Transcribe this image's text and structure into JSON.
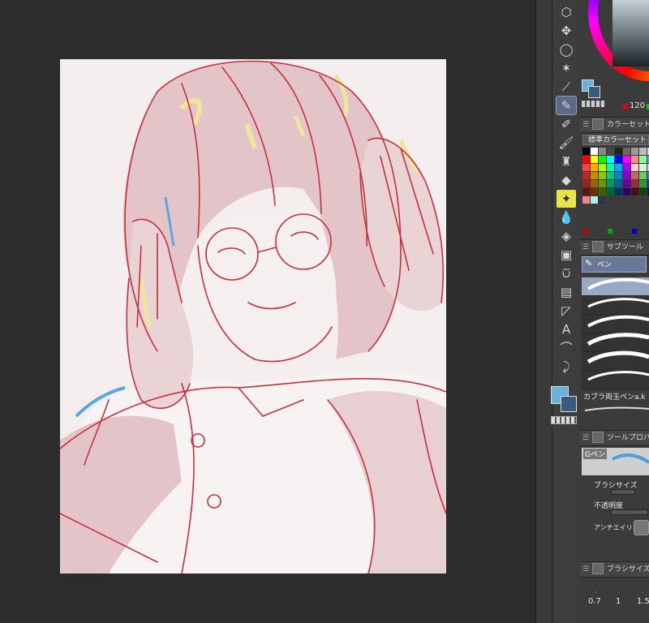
{
  "toolbar": {
    "tools": [
      {
        "name": "object-select-icon",
        "glyph": "⬡"
      },
      {
        "name": "move-icon",
        "glyph": "✥"
      },
      {
        "name": "lasso-icon",
        "glyph": "◯"
      },
      {
        "name": "magic-wand-icon",
        "glyph": "✶"
      },
      {
        "name": "eyedropper-icon",
        "glyph": "⟋"
      },
      {
        "name": "pen-tool-icon",
        "glyph": "✎",
        "active": true
      },
      {
        "name": "pencil-tool-icon",
        "glyph": "✐"
      },
      {
        "name": "brush-tool-icon",
        "glyph": "🖌"
      },
      {
        "name": "airbrush-tool-icon",
        "glyph": "♜"
      },
      {
        "name": "eraser-tool-icon",
        "glyph": "◆"
      },
      {
        "name": "decoration-tool-icon",
        "glyph": "✦",
        "highlight": true
      },
      {
        "name": "blend-tool-icon",
        "glyph": "💧"
      },
      {
        "name": "fill-tool-icon",
        "glyph": "◈"
      },
      {
        "name": "gradient-tool-icon",
        "glyph": "▣"
      },
      {
        "name": "figure-tool-icon",
        "glyph": "⩂"
      },
      {
        "name": "frame-tool-icon",
        "glyph": "▤"
      },
      {
        "name": "ruler-tool-icon",
        "glyph": "◸"
      },
      {
        "name": "text-tool-icon",
        "glyph": "A"
      },
      {
        "name": "balloon-tool-icon",
        "glyph": "⌒"
      },
      {
        "name": "correct-line-tool-icon",
        "glyph": "⤸"
      }
    ],
    "main_color": "#6ab0dc",
    "sub_color": "#3a5c7a"
  },
  "color_wheel": {
    "red_value": "120"
  },
  "color_set": {
    "panel_title": "カラーセット",
    "set_name": "標準カラーセット"
  },
  "sub_tool": {
    "panel_title": "サブツール",
    "group_name": "ペン",
    "brush_label": "カブラ両玉ペンa.k"
  },
  "tool_property": {
    "panel_title": "ツールプロパティ",
    "tool_name": "Gペン",
    "brush_size_label": "ブラシサイズ",
    "opacity_label": "不透明度",
    "antialias_label": "アンチエイリアス"
  },
  "brush_size": {
    "panel_title": "ブラシサイズ",
    "sizes": [
      "0.7",
      "1",
      "1.5"
    ]
  },
  "colors": {
    "canvas_bg": "#f4eeee",
    "line_red": "#c83040",
    "flat_pink": "#e3c4c8",
    "accent_yellow": "#ece79a",
    "accent_blue": "#5ba7dd"
  }
}
